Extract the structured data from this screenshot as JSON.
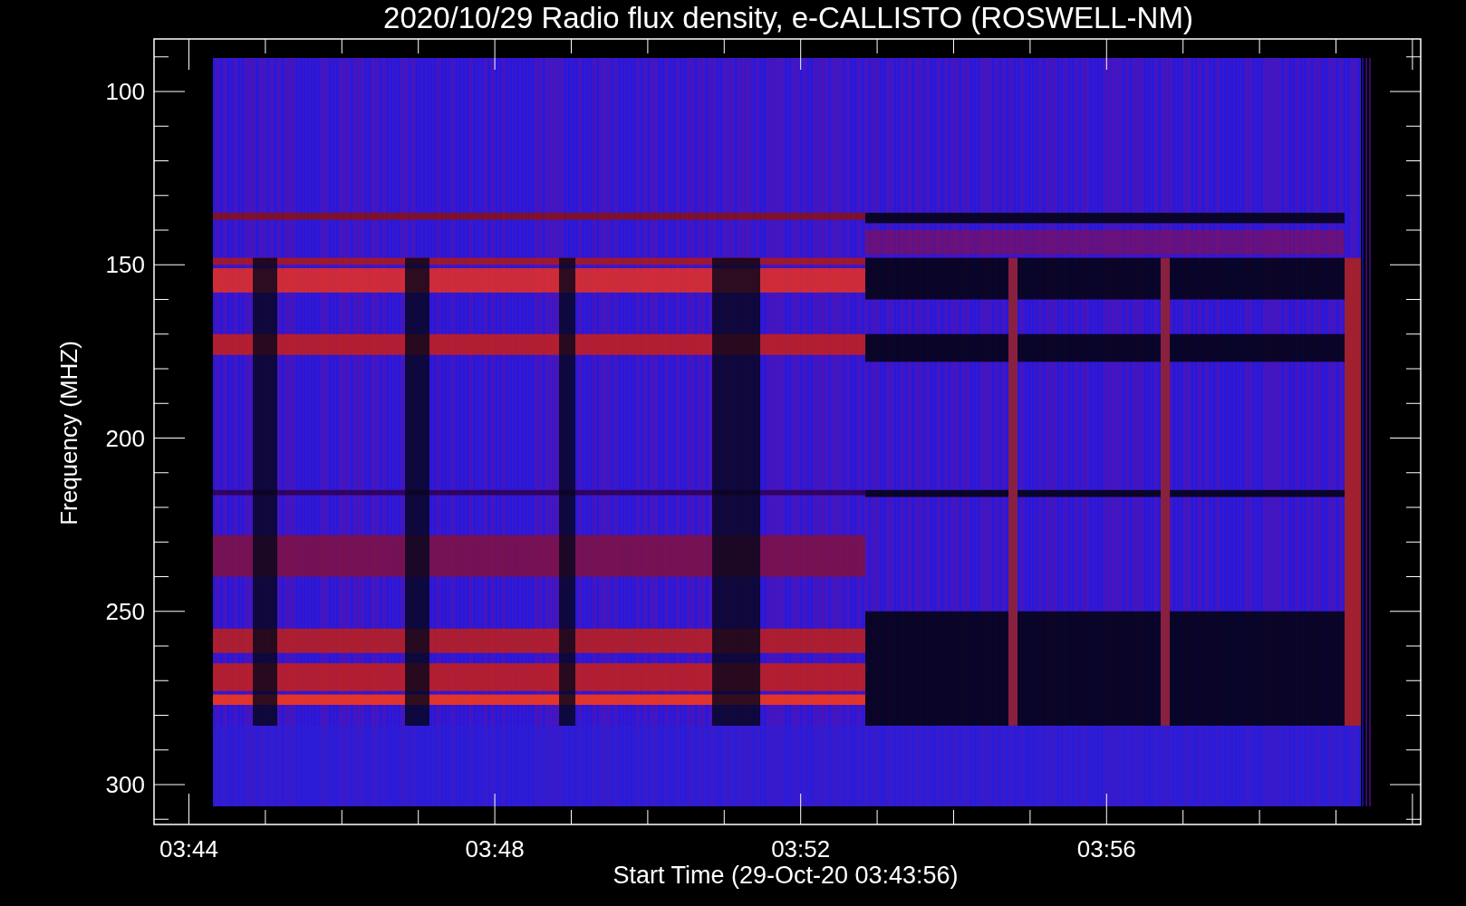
{
  "plot": {
    "title": "2020/10/29  Radio flux density, e-CALLISTO (ROSWELL-NM)",
    "ylabel": "Frequency (MHZ)",
    "xlabel": "Start Time (29-Oct-20 03:43:56)",
    "yticks": [
      "100",
      "150",
      "200",
      "250",
      "300"
    ],
    "xticks": [
      "03:44",
      "03:48",
      "03:52",
      "03:56"
    ]
  }
}
